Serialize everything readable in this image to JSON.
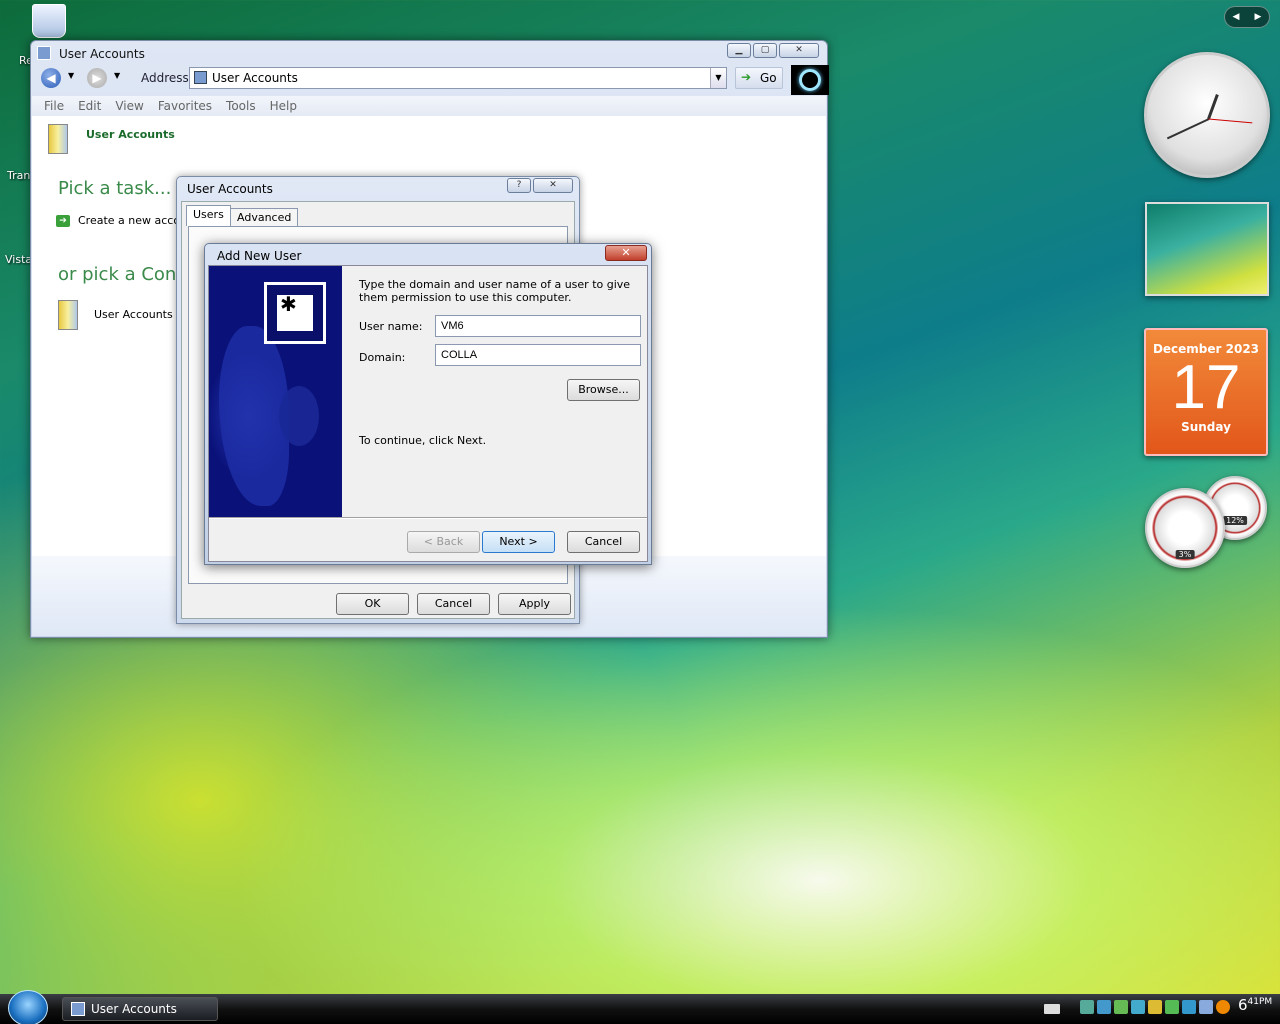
{
  "desktop": {
    "icon_labels": [
      "Re",
      "Tran",
      "Vista"
    ]
  },
  "explorer": {
    "title": "User Accounts",
    "address_label": "Address",
    "address_value": "User Accounts",
    "go_label": "Go",
    "menu": [
      "File",
      "Edit",
      "View",
      "Favorites",
      "Tools",
      "Help"
    ],
    "breadcrumb": "User Accounts",
    "pick_task": "Pick a task...",
    "task_create": "Create a new accou",
    "pick_control": "or pick a Cont",
    "control_item": "User Accounts"
  },
  "accounts_dialog": {
    "title": "User Accounts",
    "tabs": [
      "Users",
      "Advanced"
    ],
    "ok": "OK",
    "cancel": "Cancel",
    "apply": "Apply"
  },
  "add_user": {
    "title": "Add New User",
    "description": "Type the domain and user name of a user to give them permission to use this computer.",
    "username_label": "User name:",
    "username_value": "VM6",
    "domain_label": "Domain:",
    "domain_value": "COLLA",
    "browse": "Browse...",
    "continue_text": "To continue, click Next.",
    "back": "< Back",
    "next": "Next >",
    "cancel": "Cancel"
  },
  "gadgets": {
    "calendar": {
      "month": "December 2023",
      "day": "17",
      "weekday": "Sunday"
    },
    "cpu": "3%",
    "mem": "12%"
  },
  "taskbar": {
    "task": "User Accounts",
    "time_hour": "6",
    "time_min": "41",
    "time_ampm": "PM"
  },
  "colors": {
    "accent_green": "#3a8a4a",
    "banner": "#0a0f6a",
    "calendar": "#e2571a"
  }
}
